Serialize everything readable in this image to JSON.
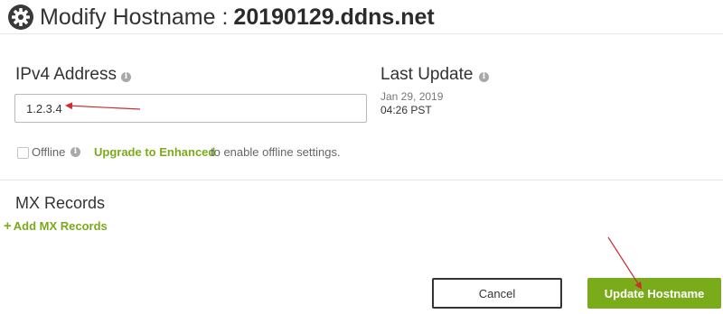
{
  "header": {
    "title_prefix": "Modify Hostname :",
    "hostname": "20190129.ddns.net",
    "icon": "gear-icon"
  },
  "ipv4": {
    "label": "IPv4 Address",
    "value": "1.2.3.4",
    "info_icon": "info-icon"
  },
  "last_update": {
    "label": "Last Update",
    "date": "Jan 29, 2019",
    "time": "04:26 PST",
    "info_icon": "info-icon"
  },
  "offline": {
    "label": "Offline",
    "checked": false,
    "upgrade_link": "Upgrade to Enhanced",
    "suffix_text": "to enable offline settings."
  },
  "mx_records": {
    "label": "MX Records",
    "add_label": "Add MX Records",
    "add_icon": "plus-icon"
  },
  "buttons": {
    "cancel": "Cancel",
    "update": "Update Hostname"
  },
  "annotations": {
    "arrow_color": "#cc2f2f"
  },
  "colors": {
    "accent_green": "#7aab1a",
    "text_dark": "#333333",
    "text_muted": "#777777",
    "divider": "#e6e6e6"
  }
}
